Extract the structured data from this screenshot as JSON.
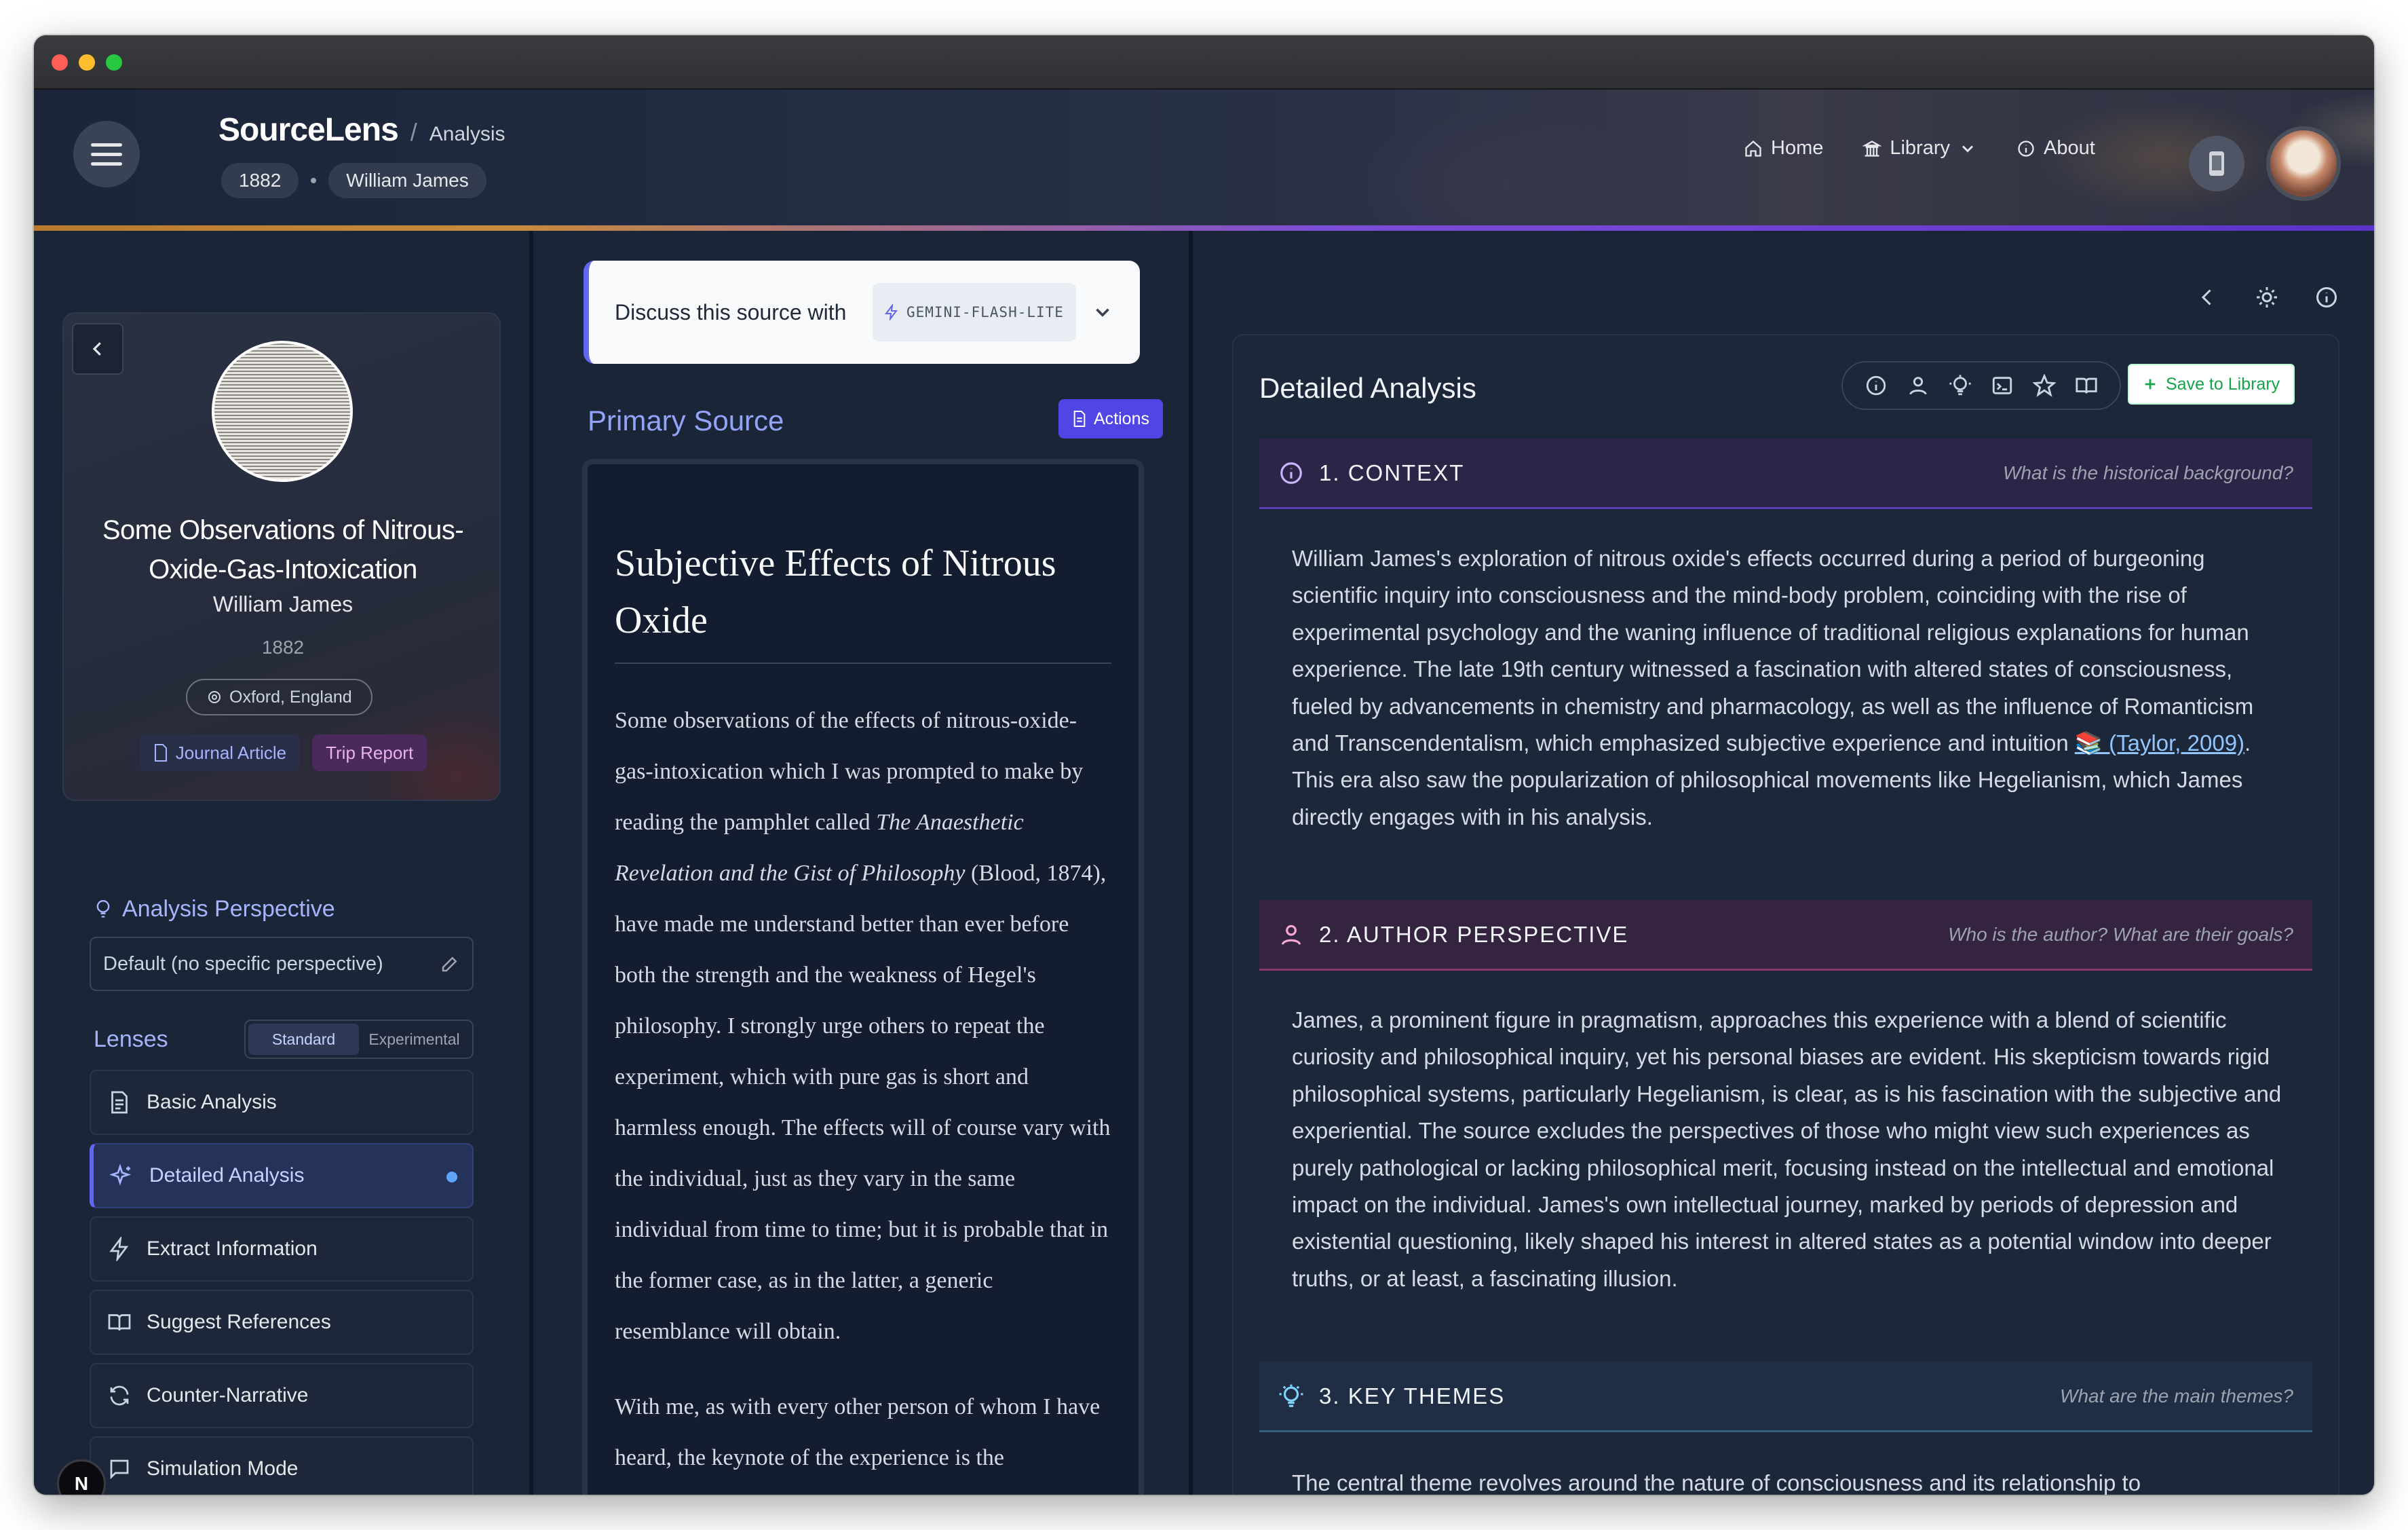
{
  "app": {
    "brand": "SourceLens",
    "breadcrumb": "Analysis",
    "chips": [
      "1882",
      "William James"
    ],
    "nav": [
      {
        "label": "Home",
        "icon": "home-icon"
      },
      {
        "label": "Library",
        "icon": "library-icon"
      },
      {
        "label": "About",
        "icon": "info-icon"
      }
    ]
  },
  "source_card": {
    "title": "Some Observations of Nitrous-Oxide-Gas-Intoxication",
    "author": "William James",
    "year": "1882",
    "location": "Oxford, England",
    "tags": [
      "Journal Article",
      "Trip Report"
    ]
  },
  "perspective": {
    "title": "Analysis Perspective",
    "value": "Default (no specific perspective)"
  },
  "lenses": {
    "title": "Lenses",
    "modes": [
      "Standard",
      "Experimental"
    ],
    "active_mode": "Standard",
    "items": [
      {
        "label": "Basic Analysis",
        "icon": "document-icon",
        "active": false
      },
      {
        "label": "Detailed Analysis",
        "icon": "sparkle-icon",
        "active": true
      },
      {
        "label": "Extract Information",
        "icon": "bolt-icon",
        "active": false
      },
      {
        "label": "Suggest References",
        "icon": "book-icon",
        "active": false
      },
      {
        "label": "Counter-Narrative",
        "icon": "refresh-icon",
        "active": false
      },
      {
        "label": "Simulation Mode",
        "icon": "chat-icon",
        "active": false
      }
    ]
  },
  "badge": "N",
  "discuss": {
    "label": "Discuss this source with",
    "model": "GEMINI-FLASH-LITE"
  },
  "primary_source": {
    "title": "Primary Source",
    "actions_label": "Actions",
    "doc_title": "Subjective Effects of Nitrous Oxide",
    "p1_a": "Some observations of the effects of nitrous-oxide-gas-intoxication which I was prompted to make by reading the pamphlet called ",
    "p1_em": "The Anaesthetic Revelation and the Gist of Philosophy",
    "p1_b": " (Blood, 1874), have made me understand better than ever before both the strength and the weakness of Hegel's philosophy. I strongly urge others to repeat the experiment, which with pure gas is short and harmless enough. The effects will of course vary with the individual, just as they vary in the same individual from time to time; but it is probable that in the former case, as in the latter, a generic resemblance will obtain.",
    "p2": "With me, as with every other person of whom I have heard, the keynote of the experience is the"
  },
  "analysis": {
    "title": "Detailed Analysis",
    "save_label": "Save to Library",
    "toolbar_icons": [
      "info-icon",
      "person-icon",
      "bulb-icon",
      "terminal-icon",
      "star-icon",
      "book-icon"
    ],
    "sections": [
      {
        "label": "1. CONTEXT",
        "question": "What is the historical background?",
        "body_a": "William James's exploration of nitrous oxide's effects occurred during a period of burgeoning scientific inquiry into consciousness and the mind-body problem, coinciding with the rise of experimental psychology and the waning influence of traditional religious explanations for human experience. The late 19th century witnessed a fascination with altered states of consciousness, fueled by advancements in chemistry and pharmacology, as well as the influence of Romanticism and Transcendentalism, which emphasized subjective experience and intuition ",
        "cite": "📚 (Taylor, 2009)",
        "body_b": ". This era also saw the popularization of philosophical movements like Hegelianism, which James directly engages with in his analysis."
      },
      {
        "label": "2. AUTHOR PERSPECTIVE",
        "question": "Who is the author? What are their goals?",
        "body": "James, a prominent figure in pragmatism, approaches this experience with a blend of scientific curiosity and philosophical inquiry, yet his personal biases are evident. His skepticism towards rigid philosophical systems, particularly Hegelianism, is clear, as is his fascination with the subjective and experiential. The source excludes the perspectives of those who might view such experiences as purely pathological or lacking philosophical merit, focusing instead on the intellectual and emotional impact on the individual. James's own intellectual journey, marked by periods of depression and existential questioning, likely shaped his interest in altered states as a potential window into deeper truths, or at least, a fascinating illusion."
      },
      {
        "label": "3. KEY THEMES",
        "question": "What are the main themes?",
        "body": "The central theme revolves around the nature of consciousness and its relationship to"
      }
    ]
  }
}
